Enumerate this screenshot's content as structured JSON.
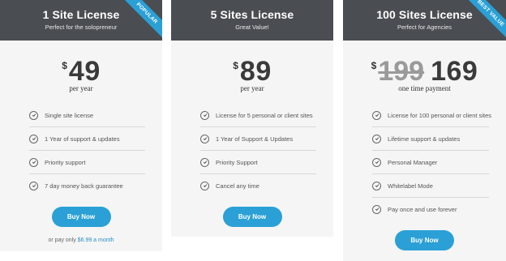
{
  "colors": {
    "header": "#4a4d52",
    "accent": "#2aa0d6",
    "card_bg": "#f5f5f5"
  },
  "plans": [
    {
      "title": "1 Site License",
      "subtitle": "Perfect for the solopreneur",
      "ribbon": "POPULAR",
      "currency": "$",
      "old_price": "",
      "price": "49",
      "period": "per year",
      "features": [
        "Single site license",
        "1 Year of support & updates",
        "Priority support",
        "7 day money back guarantee"
      ],
      "button": "Buy Now",
      "footnote_text": "or pay only",
      "footnote_link": "$6.99 a month"
    },
    {
      "title": "5 Sites License",
      "subtitle": "Great Value!",
      "ribbon": "",
      "currency": "$",
      "old_price": "",
      "price": "89",
      "period": "per year",
      "features": [
        "License for 5 personal or client sites",
        "1 Year of Support & Updates",
        "Priority Support",
        "Cancel any time"
      ],
      "button": "Buy Now"
    },
    {
      "title": "100 Sites License",
      "subtitle": "Perfect for Agencies",
      "ribbon": "BEST VALUE",
      "currency": "$",
      "old_price": "199",
      "price": "169",
      "period": "one time payment",
      "features": [
        "License for 100 personal or client sites",
        "Lifetime support & updates",
        "Personal Manager",
        "Whitelabel Mode",
        "Pay once and use forever"
      ],
      "button": "Buy Now"
    }
  ]
}
